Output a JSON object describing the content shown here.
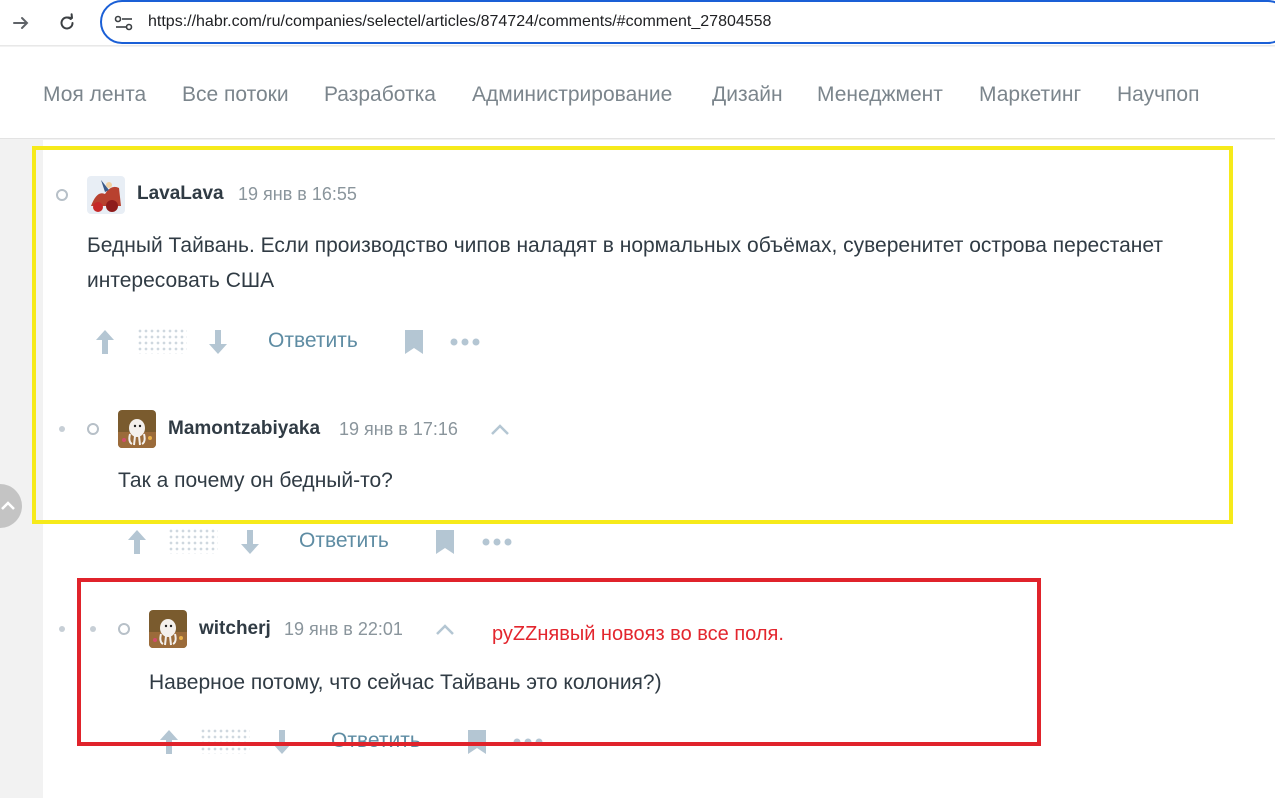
{
  "browser": {
    "url": "https://habr.com/ru/companies/selectel/articles/874724/comments/#comment_27804558",
    "back_icon": "arrow-right-icon",
    "reload_icon": "reload-icon"
  },
  "topnav": {
    "items": [
      "Моя лента",
      "Все потоки",
      "Разработка",
      "Администрирование",
      "Дизайн",
      "Менеджмент",
      "Маркетинг",
      "Научпоп"
    ]
  },
  "comments": [
    {
      "username": "LavaLava",
      "time": "19 янв в 16:55",
      "text": "Бедный Тайвань. Если производство чипов наладят в нормальных объёмах, суверенитет острова перестанет интересовать США",
      "reply": "Ответить"
    },
    {
      "username": "Mamontzabiyaka",
      "time": "19 янв в 17:16",
      "text": "Так а почему он бедный-то?",
      "reply": "Ответить"
    },
    {
      "username": "witcherj",
      "time": "19 янв в 22:01",
      "text": "Наверное потому, что сейчас Тайвань это колония?)",
      "reply": "Ответить"
    }
  ],
  "annotation": {
    "text": "руZZнявый новояз во все поля.",
    "color": "#e3262e"
  },
  "highlight_colors": {
    "yellow": "#f6ea1a",
    "red": "#e0232b",
    "link": "#5e8ca3"
  }
}
